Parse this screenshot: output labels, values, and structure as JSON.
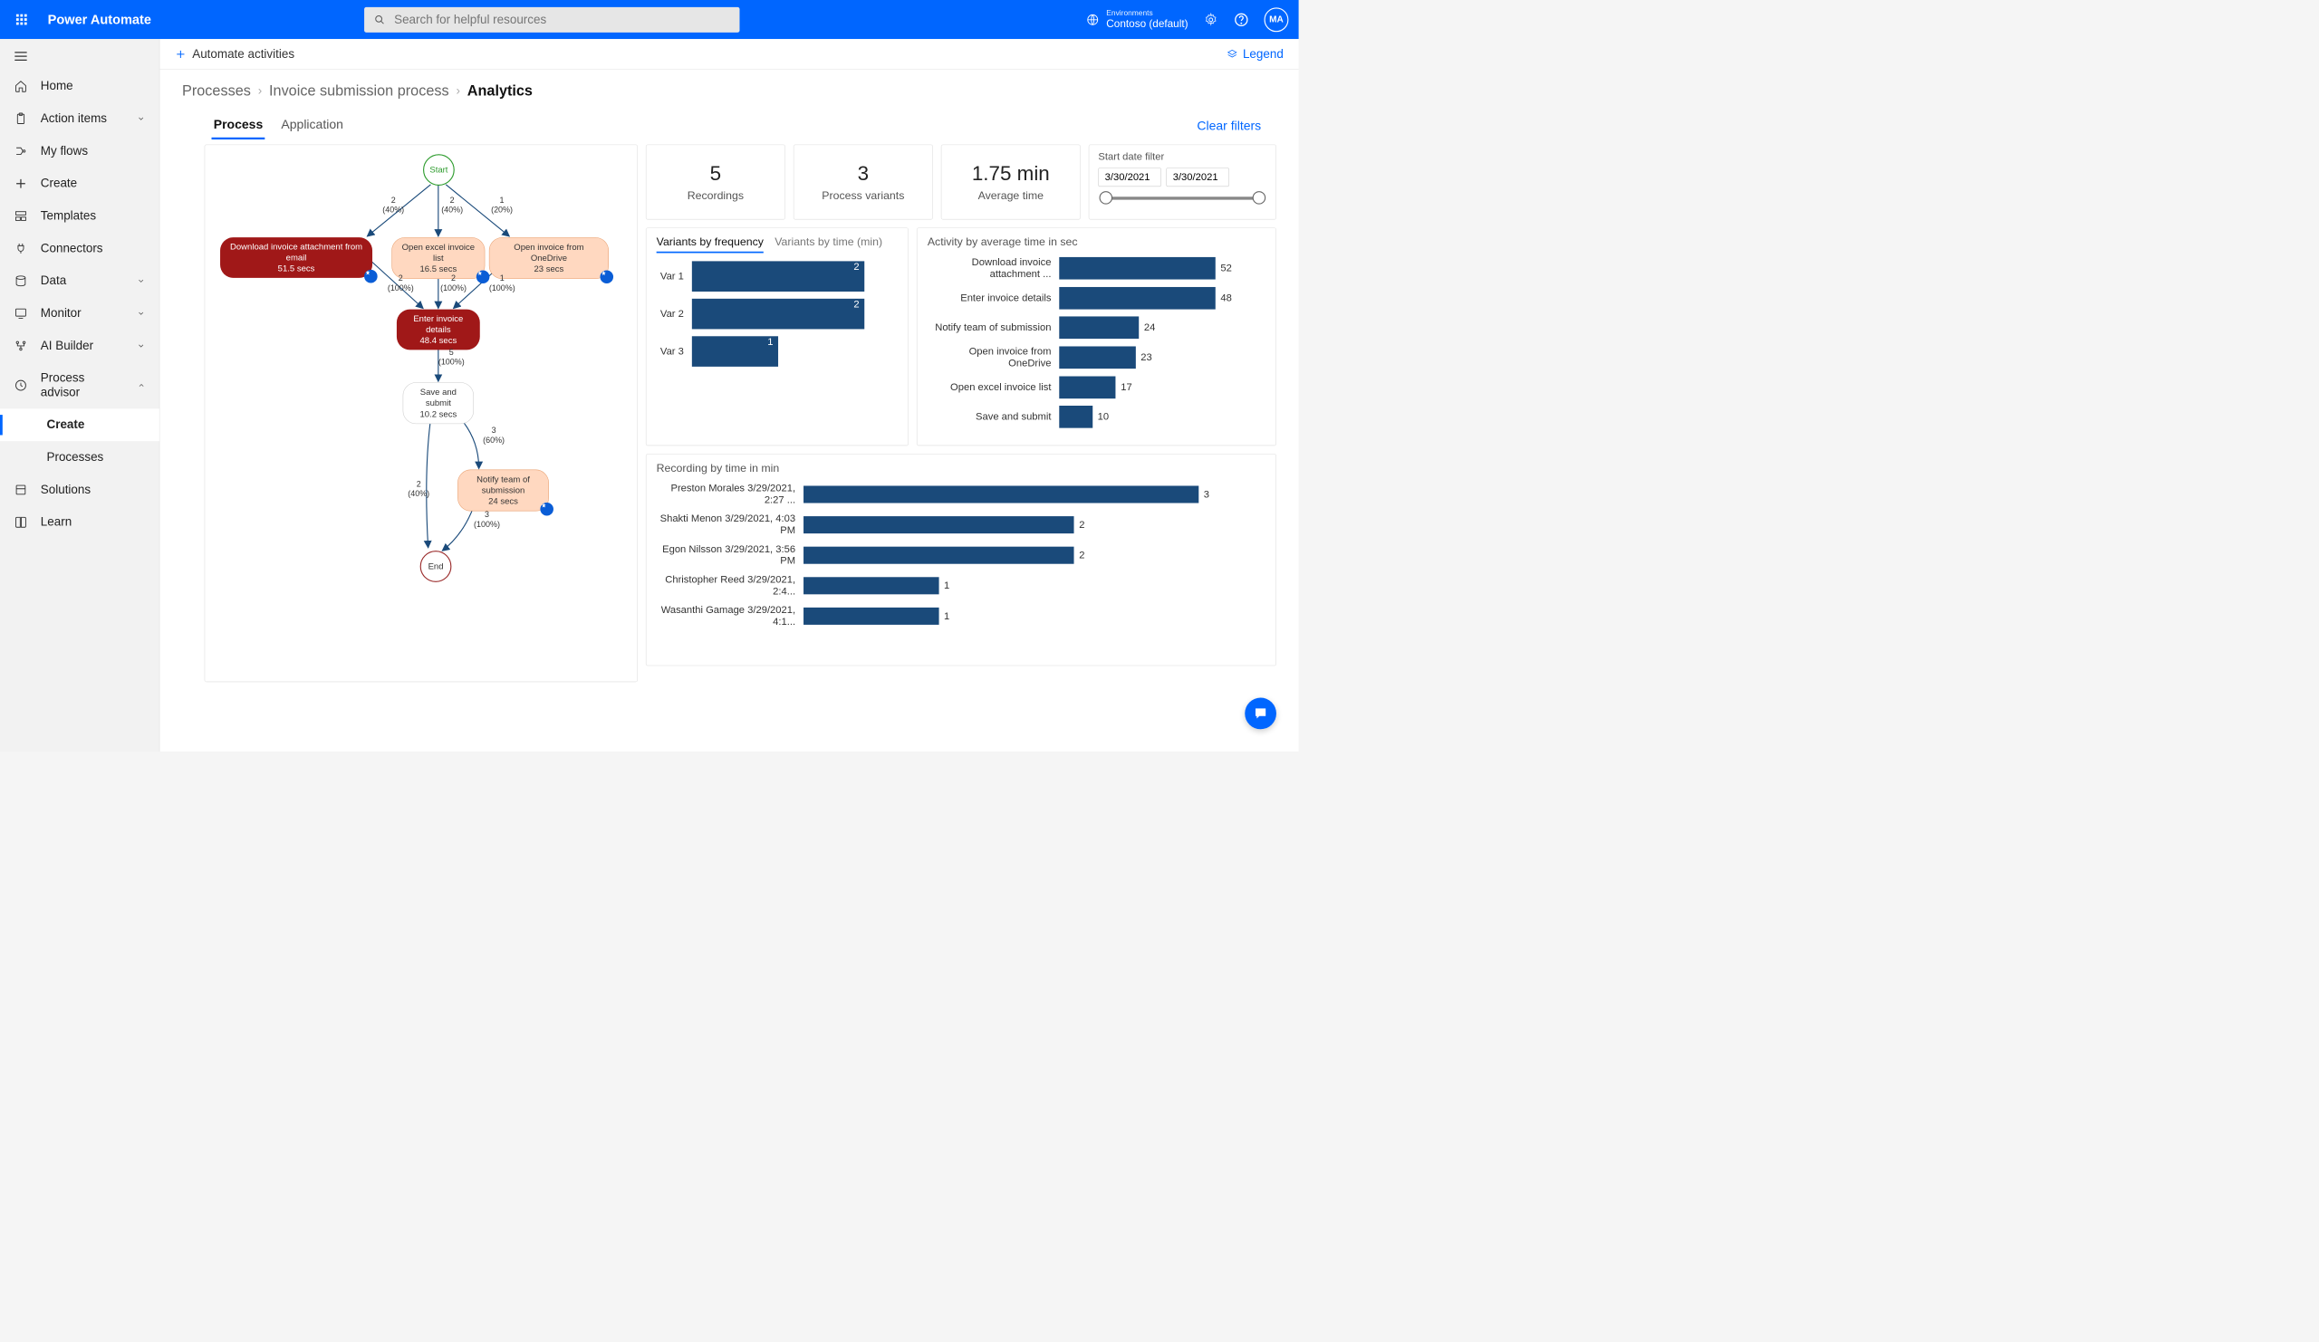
{
  "header": {
    "app_title": "Power Automate",
    "search_placeholder": "Search for helpful resources",
    "env_label": "Environments",
    "env_name": "Contoso (default)",
    "avatar_initials": "MA"
  },
  "nav": {
    "items": [
      {
        "label": "Home"
      },
      {
        "label": "Action items",
        "expandable": true
      },
      {
        "label": "My flows"
      },
      {
        "label": "Create"
      },
      {
        "label": "Templates"
      },
      {
        "label": "Connectors"
      },
      {
        "label": "Data",
        "expandable": true
      },
      {
        "label": "Monitor",
        "expandable": true
      },
      {
        "label": "AI Builder",
        "expandable": true
      },
      {
        "label": "Process advisor",
        "expandable": true,
        "expanded": true
      },
      {
        "label": "Create",
        "sub": true,
        "active": true
      },
      {
        "label": "Processes",
        "sub": true
      },
      {
        "label": "Solutions"
      },
      {
        "label": "Learn"
      }
    ]
  },
  "command_bar": {
    "automate": "Automate activities",
    "legend": "Legend"
  },
  "breadcrumb": {
    "a": "Processes",
    "b": "Invoice submission process",
    "c": "Analytics"
  },
  "tabs": {
    "process": "Process",
    "application": "Application",
    "clear_filters": "Clear filters"
  },
  "kpis": {
    "recordings_num": "5",
    "recordings_label": "Recordings",
    "variants_num": "3",
    "variants_label": "Process variants",
    "avg_num": "1.75 min",
    "avg_label": "Average time",
    "date_filter_title": "Start date filter",
    "date_from": "3/30/2021",
    "date_to": "3/30/2021"
  },
  "variants_panel": {
    "tab_freq": "Variants by frequency",
    "tab_time": "Variants by time (min)"
  },
  "activity_panel": {
    "title": "Activity by average time in sec"
  },
  "recording_panel": {
    "title": "Recording by time in min"
  },
  "flowchart": {
    "start": "Start",
    "end": "End",
    "n1": "Download invoice attachment from email",
    "n1t": "51.5 secs",
    "n2": "Open excel invoice list",
    "n2t": "16.5 secs",
    "n3": "Open invoice from OneDrive",
    "n3t": "23 secs",
    "n4": "Enter invoice details",
    "n4t": "48.4 secs",
    "n5": "Save and submit",
    "n5t": "10.2 secs",
    "n6": "Notify team of submission",
    "n6t": "24 secs",
    "e1": "2\n(40%)",
    "e2": "2\n(40%)",
    "e3": "1\n(20%)",
    "e4": "2\n(100%)",
    "e5": "2\n(100%)",
    "e6": "1\n(100%)",
    "e7": "5\n(100%)",
    "e8": "3\n(60%)",
    "e9": "2\n(40%)",
    "e10": "3\n(100%)"
  },
  "chart_data": {
    "variants_by_frequency": {
      "type": "bar",
      "categories": [
        "Var 1",
        "Var 2",
        "Var 3"
      ],
      "values": [
        2,
        2,
        1
      ],
      "xlabel": "",
      "ylabel": ""
    },
    "activity_by_avg_time": {
      "type": "bar",
      "categories": [
        "Download invoice attachment ...",
        "Enter invoice details",
        "Notify team of submission",
        "Open invoice from OneDrive",
        "Open excel invoice list",
        "Save and submit"
      ],
      "values": [
        52,
        48,
        24,
        23,
        17,
        10
      ],
      "title": "Activity by average time in sec"
    },
    "recording_by_time": {
      "type": "bar",
      "categories": [
        "Preston Morales 3/29/2021, 2:27 ...",
        "Shakti Menon 3/29/2021, 4:03 PM",
        "Egon Nilsson 3/29/2021, 3:56 PM",
        "Christopher Reed 3/29/2021, 2:4...",
        "Wasanthi Gamage 3/29/2021, 4:1..."
      ],
      "values": [
        3,
        2,
        2,
        1,
        1
      ],
      "title": "Recording by time in min"
    }
  }
}
